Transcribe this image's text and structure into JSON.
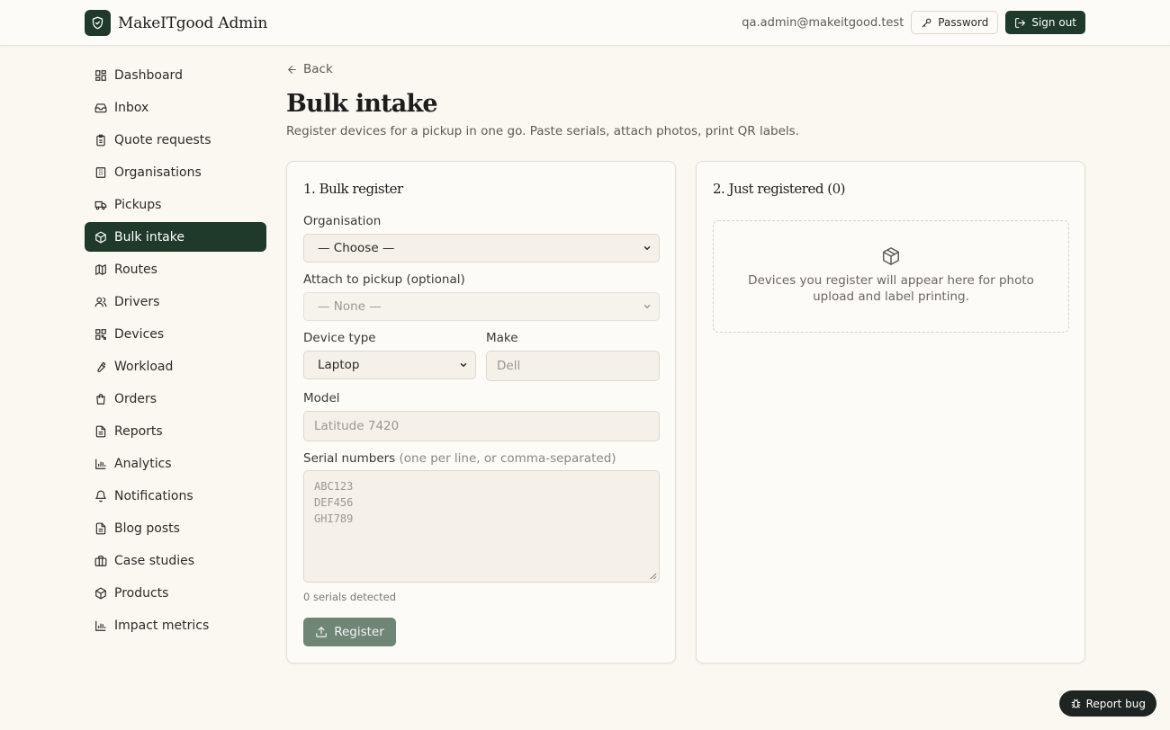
{
  "app": {
    "title": "MakeITgood Admin"
  },
  "header": {
    "user_email": "qa.admin@makeitgood.test",
    "password_label": "Password",
    "signout_label": "Sign out"
  },
  "sidebar": {
    "items": [
      {
        "label": "Dashboard",
        "icon": "dashboard-icon"
      },
      {
        "label": "Inbox",
        "icon": "inbox-icon"
      },
      {
        "label": "Quote requests",
        "icon": "clipboard-icon"
      },
      {
        "label": "Organisations",
        "icon": "building-icon"
      },
      {
        "label": "Pickups",
        "icon": "truck-icon"
      },
      {
        "label": "Bulk intake",
        "icon": "package-icon",
        "active": true
      },
      {
        "label": "Routes",
        "icon": "map-icon"
      },
      {
        "label": "Drivers",
        "icon": "users-icon"
      },
      {
        "label": "Devices",
        "icon": "qr-code-icon"
      },
      {
        "label": "Workload",
        "icon": "wrench-icon"
      },
      {
        "label": "Orders",
        "icon": "shopping-bag-icon"
      },
      {
        "label": "Reports",
        "icon": "file-text-icon"
      },
      {
        "label": "Analytics",
        "icon": "bar-chart-icon"
      },
      {
        "label": "Notifications",
        "icon": "bell-icon"
      },
      {
        "label": "Blog posts",
        "icon": "file-text-icon"
      },
      {
        "label": "Case studies",
        "icon": "briefcase-icon"
      },
      {
        "label": "Products",
        "icon": "package-icon"
      },
      {
        "label": "Impact metrics",
        "icon": "bar-chart-icon"
      }
    ]
  },
  "main": {
    "back_label": "Back",
    "title": "Bulk intake",
    "subtitle": "Register devices for a pickup in one go. Paste serials, attach photos, print QR labels.",
    "form": {
      "title": "1. Bulk register",
      "organisation_label": "Organisation",
      "organisation_value": "— Choose —",
      "pickup_label": "Attach to pickup (optional)",
      "pickup_value": "— None —",
      "device_type_label": "Device type",
      "device_type_value": "Laptop",
      "make_label": "Make",
      "make_placeholder": "Dell",
      "model_label": "Model",
      "model_placeholder": "Latitude 7420",
      "serials_label": "Serial numbers",
      "serials_hint": "(one per line, or comma-separated)",
      "serials_placeholder": [
        "ABC123",
        "DEF456",
        "GHI789"
      ],
      "serial_count": "0 serials detected",
      "register_label": "Register"
    },
    "registered": {
      "title": "2. Just registered (0)",
      "empty_text": "Devices you register will appear here for photo upload and label printing."
    }
  },
  "footer": {
    "report_bug_label": "Report bug"
  },
  "colors": {
    "brand": "#1f3a2b",
    "background": "#fbf8f2",
    "register_button": "#6f8576"
  }
}
